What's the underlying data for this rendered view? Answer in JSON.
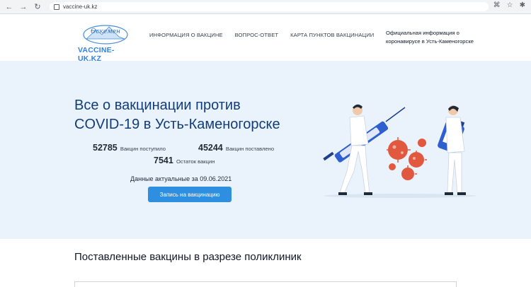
{
  "browser": {
    "url": "vaccine-uk.kz"
  },
  "logo": {
    "script_text": "Өскемен",
    "site_name": "VACCINE-UK.KZ"
  },
  "menu": [
    {
      "label": "ИНФОРМАЦИЯ О ВАКЦИНЕ"
    },
    {
      "label": "ВОПРОС-ОТВЕТ"
    },
    {
      "label": "КАРТА ПУНКТОВ ВАКЦИНАЦИИ"
    }
  ],
  "header": {
    "official_line1": "Официальная информация о",
    "official_line2": "коронавирусе в Усть-Каменогорске"
  },
  "hero": {
    "title_line1": "Все о вакцинации против",
    "title_line2": "COVID-19 в Усть-Каменогорске",
    "stats": {
      "received": {
        "value": "52785",
        "label": "Вакцин поступило"
      },
      "delivered": {
        "value": "45244",
        "label": "Вакцин поставлено"
      },
      "remaining": {
        "value": "7541",
        "label": "Остаток вакцин"
      }
    },
    "updated": "Данные актуальные за 09.06.2021",
    "cta_label": "Запись на вакцинацию"
  },
  "section": {
    "title": "Поставленные вакцины в разрезе поликлиник"
  },
  "colors": {
    "accent": "#2e8ee0",
    "hero_bg": "#eaf3fb",
    "title": "#123d7a",
    "virus": "#e2583e",
    "syringe": "#2f5fd0"
  }
}
